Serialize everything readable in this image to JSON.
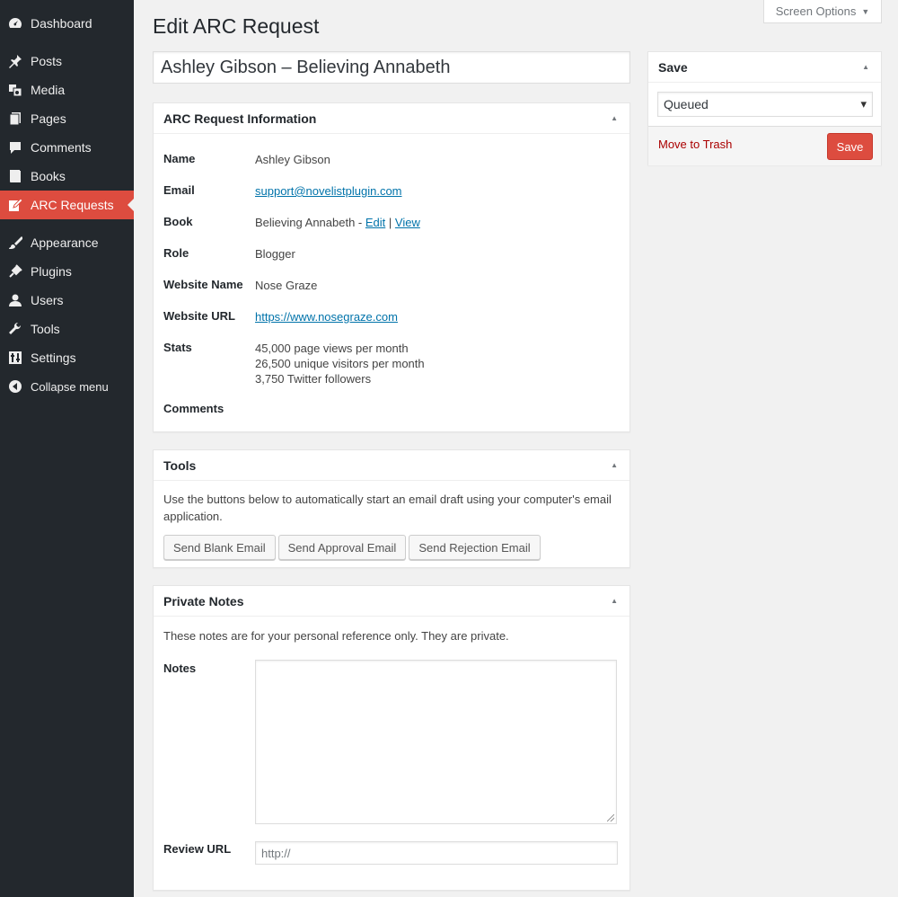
{
  "sidebar": {
    "items": [
      {
        "label": "Dashboard",
        "icon": "dashboard-icon"
      },
      {
        "label": "Posts",
        "icon": "pin-icon"
      },
      {
        "label": "Media",
        "icon": "media-icon"
      },
      {
        "label": "Pages",
        "icon": "pages-icon"
      },
      {
        "label": "Comments",
        "icon": "comment-icon"
      },
      {
        "label": "Books",
        "icon": "book-icon"
      },
      {
        "label": "ARC Requests",
        "icon": "edit-icon"
      },
      {
        "label": "Appearance",
        "icon": "brush-icon"
      },
      {
        "label": "Plugins",
        "icon": "plug-icon"
      },
      {
        "label": "Users",
        "icon": "user-icon"
      },
      {
        "label": "Tools",
        "icon": "wrench-icon"
      },
      {
        "label": "Settings",
        "icon": "settings-icon"
      },
      {
        "label": "Collapse menu",
        "icon": "collapse-icon"
      }
    ],
    "active_color": "#dd4c3f",
    "background": "#23282d"
  },
  "screen_options": {
    "label": "Screen Options",
    "arrow": "▼"
  },
  "page_title": "Edit ARC Request",
  "title_value": "Ashley Gibson – Believing Annabeth",
  "info_box": {
    "title": "ARC Request Information",
    "toggle": "▲",
    "rows": {
      "name": {
        "label": "Name",
        "value": "Ashley Gibson"
      },
      "email": {
        "label": "Email",
        "value": "support@novelistplugin.com"
      },
      "book": {
        "label": "Book",
        "value": "Believing Annabeth - ",
        "edit": "Edit",
        "sep": " | ",
        "view": "View"
      },
      "role": {
        "label": "Role",
        "value": "Blogger"
      },
      "website_name": {
        "label": "Website Name",
        "value": "Nose Graze"
      },
      "website_url": {
        "label": "Website URL",
        "value": "https://www.nosegraze.com"
      },
      "stats": {
        "label": "Stats",
        "lines": [
          "45,000 page views per month",
          "26,500 unique visitors per month",
          "3,750 Twitter followers"
        ]
      },
      "comments": {
        "label": "Comments"
      }
    }
  },
  "tools_box": {
    "title": "Tools",
    "toggle": "▲",
    "description": "Use the buttons below to automatically start an email draft using your computer's email application.",
    "buttons": {
      "blank": "Send Blank Email",
      "approval": "Send Approval Email",
      "rejection": "Send Rejection Email"
    }
  },
  "notes_box": {
    "title": "Private Notes",
    "toggle": "▲",
    "description": "These notes are for your personal reference only. They are private.",
    "notes_label": "Notes",
    "review_label": "Review URL",
    "review_placeholder": "http://"
  },
  "save_box": {
    "title": "Save",
    "toggle": "▲",
    "status": "Queued",
    "select_arrow": "▾",
    "trash": "Move to Trash",
    "save": "Save"
  }
}
